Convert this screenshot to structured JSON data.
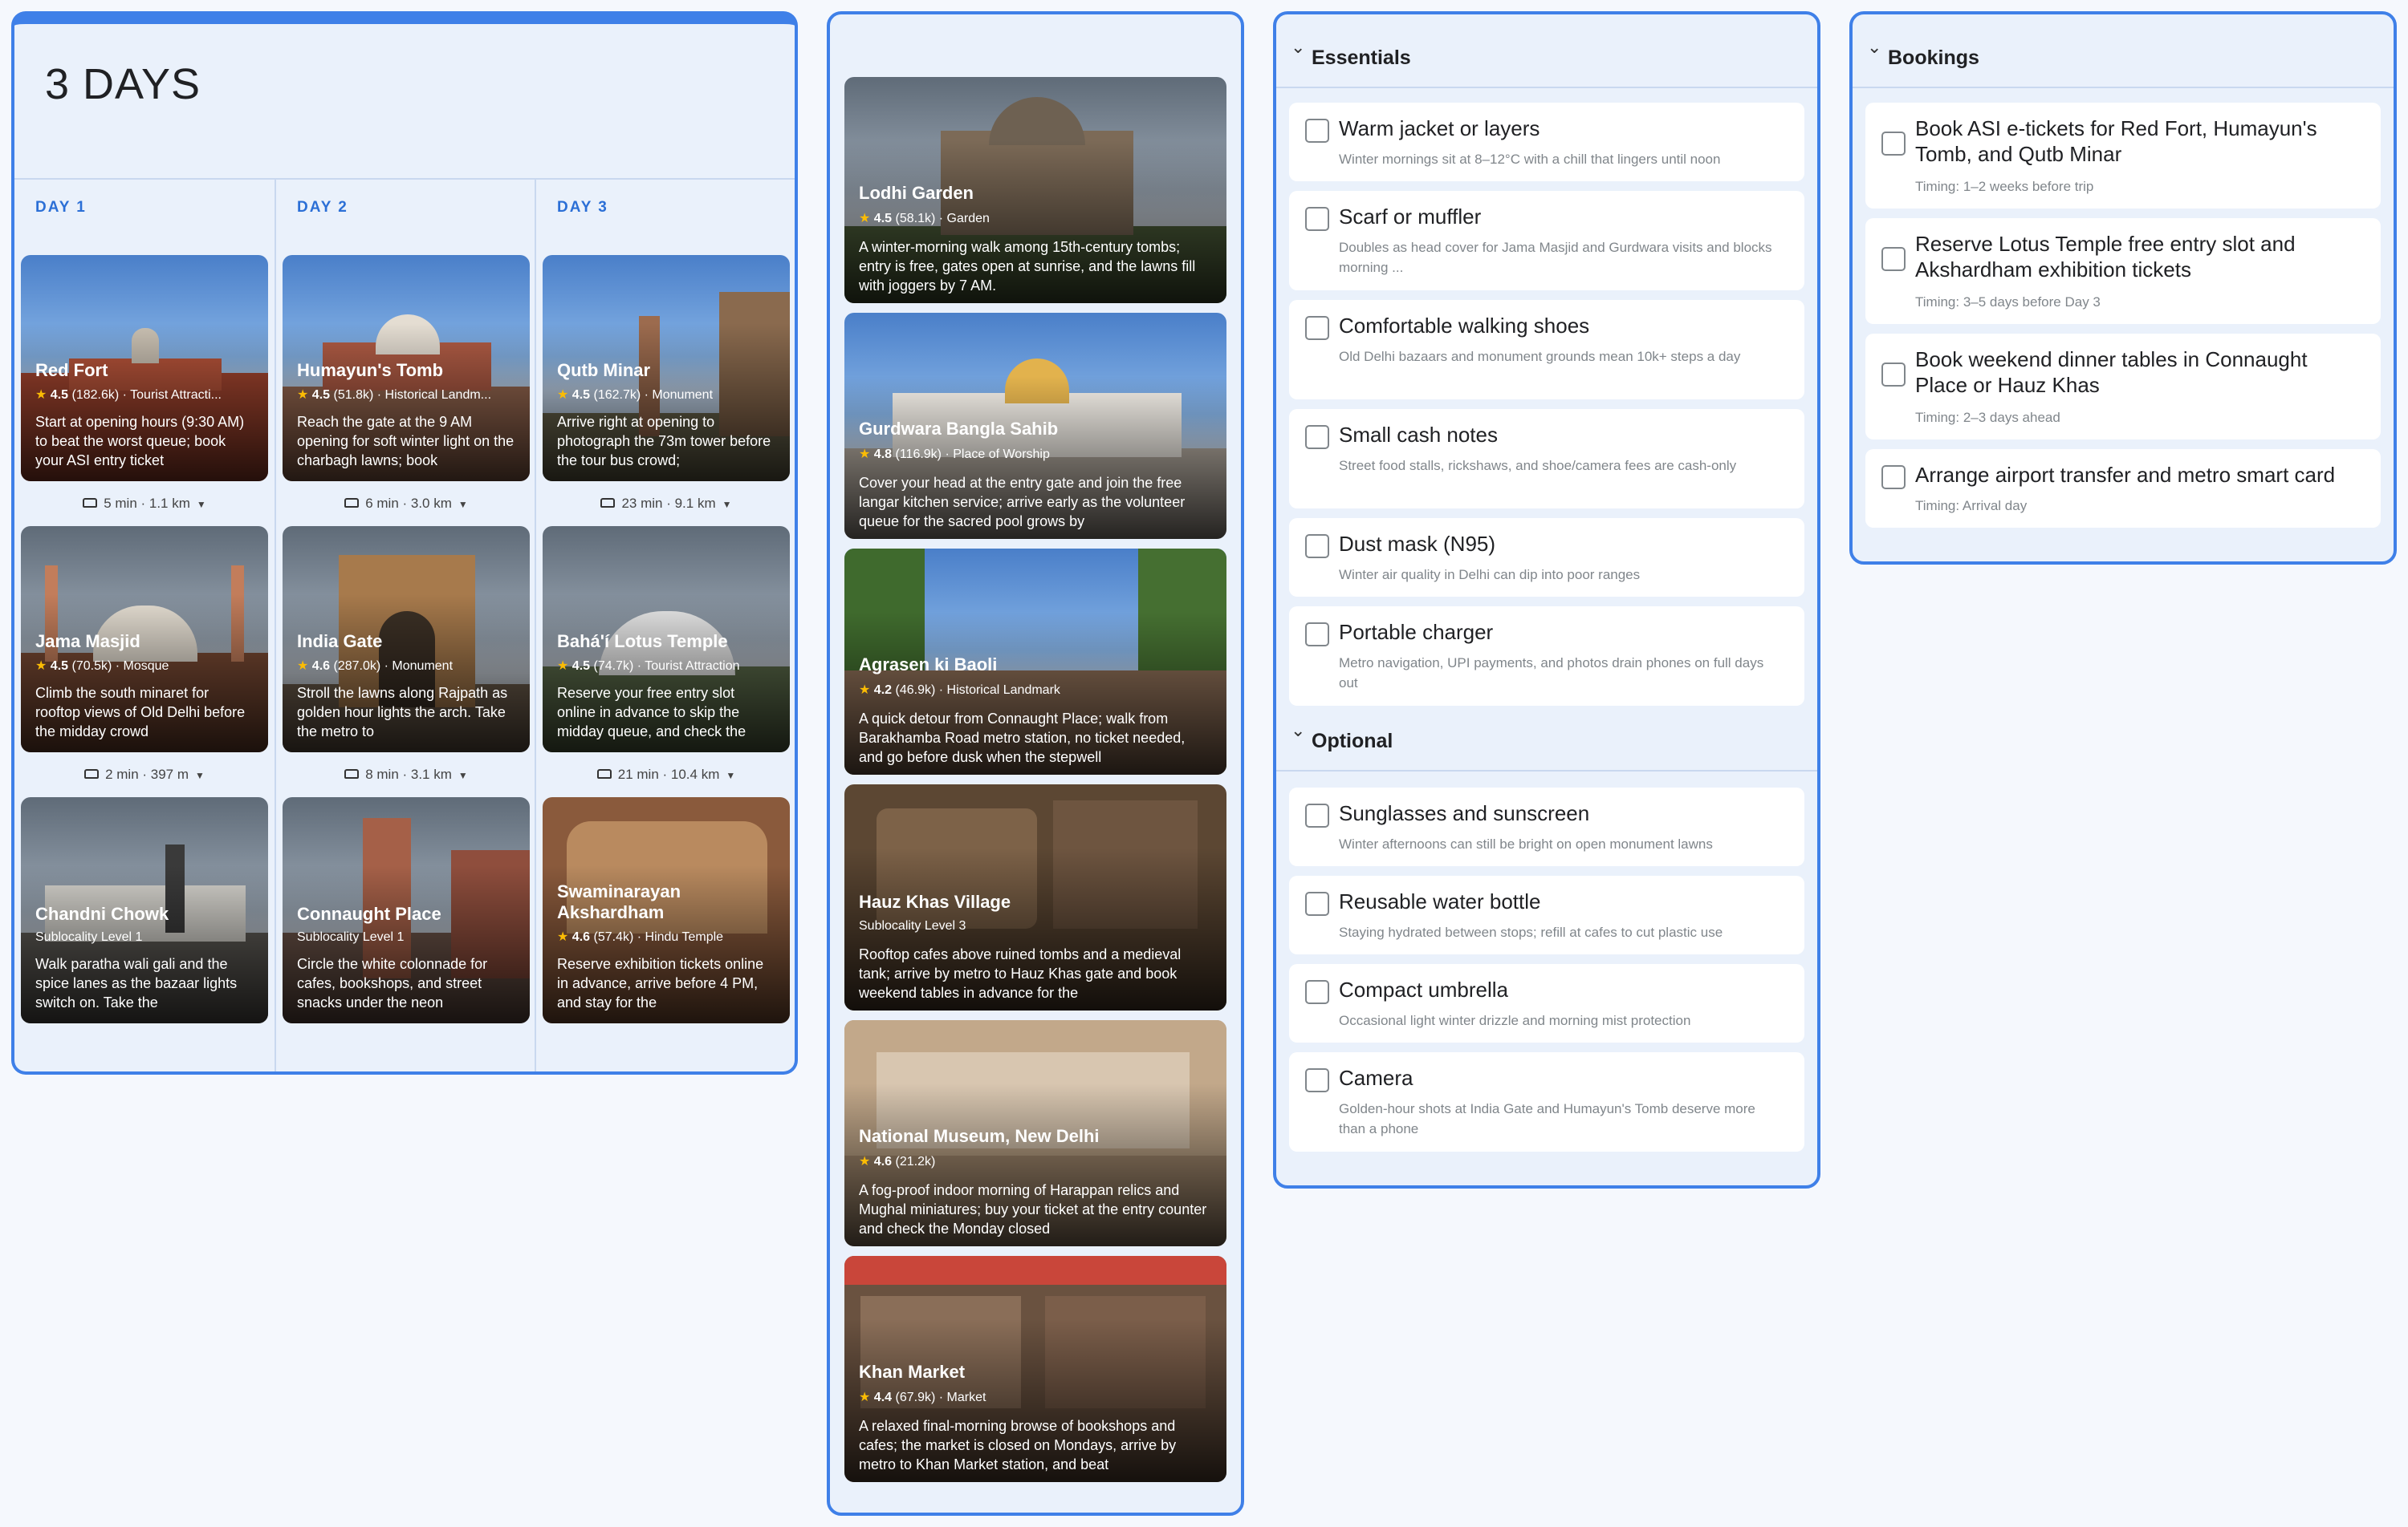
{
  "itinerary": {
    "title": "3 DAYS",
    "days": [
      {
        "label": "DAY 1",
        "places": [
          {
            "name": "Red Fort",
            "rating": "4.5",
            "reviews": "(182.6k)",
            "category": "Tourist Attracti...",
            "desc": "Start at opening hours (9:30 AM) to beat the worst queue; book your ASI entry ticket"
          },
          {
            "name": "Jama Masjid",
            "rating": "4.5",
            "reviews": "(70.5k)",
            "category": "Mosque",
            "desc": "Climb the south minaret for rooftop views of Old Delhi before the midday crowd"
          },
          {
            "name": "Chandni Chowk",
            "rating": "",
            "reviews": "",
            "category": "Sublocality Level 1",
            "desc": "Walk paratha wali gali and the spice lanes as the bazaar lights switch on. Take the"
          }
        ],
        "travel": [
          "5 min · 1.1 km",
          "2 min · 397 m"
        ]
      },
      {
        "label": "DAY 2",
        "places": [
          {
            "name": "Humayun's Tomb",
            "rating": "4.5",
            "reviews": "(51.8k)",
            "category": "Historical Landm...",
            "desc": "Reach the gate at the 9 AM opening for soft winter light on the charbagh lawns; book"
          },
          {
            "name": "India Gate",
            "rating": "4.6",
            "reviews": "(287.0k)",
            "category": "Monument",
            "desc": "Stroll the lawns along Rajpath as golden hour lights the arch. Take the metro to"
          },
          {
            "name": "Connaught Place",
            "rating": "",
            "reviews": "",
            "category": "Sublocality Level 1",
            "desc": "Circle the white colonnade for cafes, bookshops, and street snacks under the neon"
          }
        ],
        "travel": [
          "6 min · 3.0 km",
          "8 min · 3.1 km"
        ]
      },
      {
        "label": "DAY 3",
        "places": [
          {
            "name": "Qutb Minar",
            "rating": "4.5",
            "reviews": "(162.7k)",
            "category": "Monument",
            "desc": "Arrive right at opening to photograph the 73m tower before the tour bus crowd;"
          },
          {
            "name": "Bahá'í Lotus Temple",
            "rating": "4.5",
            "reviews": "(74.7k)",
            "category": "Tourist Attraction",
            "desc": "Reserve your free entry slot online in advance to skip the midday queue, and check the"
          },
          {
            "name": "Swaminarayan Akshardham",
            "rating": "4.6",
            "reviews": "(57.4k)",
            "category": "Hindu Temple",
            "desc": "Reserve exhibition tickets online in advance, arrive before 4 PM, and stay for the"
          }
        ],
        "travel": [
          "23 min · 9.1 km",
          "21 min · 10.4 km"
        ]
      }
    ]
  },
  "places_list": [
    {
      "name": "Lodhi Garden",
      "rating": "4.5",
      "reviews": "(58.1k)",
      "category": "Garden",
      "desc": "A winter-morning walk among 15th-century tombs; entry is free, gates open at sunrise, and the lawns fill with joggers by 7 AM."
    },
    {
      "name": "Gurdwara Bangla Sahib",
      "rating": "4.8",
      "reviews": "(116.9k)",
      "category": "Place of Worship",
      "desc": "Cover your head at the entry gate and join the free langar kitchen service; arrive early as the volunteer queue for the sacred pool grows by"
    },
    {
      "name": "Agrasen ki Baoli",
      "rating": "4.2",
      "reviews": "(46.9k)",
      "category": "Historical Landmark",
      "desc": "A quick detour from Connaught Place; walk from Barakhamba Road metro station, no ticket needed, and go before dusk when the stepwell"
    },
    {
      "name": "Hauz Khas Village",
      "rating": "",
      "reviews": "",
      "category": "Sublocality Level 3",
      "desc": "Rooftop cafes above ruined tombs and a medieval tank; arrive by metro to Hauz Khas gate and book weekend tables in advance for the"
    },
    {
      "name": "National Museum, New Delhi",
      "rating": "4.6",
      "reviews": "(21.2k)",
      "category": "",
      "desc": "A fog-proof indoor morning of Harappan relics and Mughal miniatures; buy your ticket at the entry counter and check the Monday closed"
    },
    {
      "name": "Khan Market",
      "rating": "4.4",
      "reviews": "(67.9k)",
      "category": "Market",
      "desc": "A relaxed final-morning browse of bookshops and cafes; the market is closed on Mondays, arrive by metro to Khan Market station, and beat"
    }
  ],
  "packing": {
    "essentials_label": "Essentials",
    "essentials": [
      {
        "title": "Warm jacket or layers",
        "sub": "Winter mornings sit at 8–12°C with a chill that lingers until noon"
      },
      {
        "title": "Scarf or muffler",
        "sub": "Doubles as head cover for Jama Masjid and Gurdwara visits and blocks morning ..."
      },
      {
        "title": "Comfortable walking shoes",
        "sub": "Old Delhi bazaars and monument grounds mean 10k+ steps a day"
      },
      {
        "title": "Small cash notes",
        "sub": "Street food stalls, rickshaws, and shoe/camera fees are cash-only"
      },
      {
        "title": "Dust mask (N95)",
        "sub": "Winter air quality in Delhi can dip into poor ranges"
      },
      {
        "title": "Portable charger",
        "sub": "Metro navigation, UPI payments, and photos drain phones on full days out"
      }
    ],
    "optional_label": "Optional",
    "optional": [
      {
        "title": "Sunglasses and sunscreen",
        "sub": "Winter afternoons can still be bright on open monument lawns"
      },
      {
        "title": "Reusable water bottle",
        "sub": "Staying hydrated between stops; refill at cafes to cut plastic use"
      },
      {
        "title": "Compact umbrella",
        "sub": "Occasional light winter drizzle and morning mist protection"
      },
      {
        "title": "Camera",
        "sub": "Golden-hour shots at India Gate and Humayun's Tomb deserve more than a phone"
      }
    ]
  },
  "bookings": {
    "label": "Bookings",
    "items": [
      {
        "title": "Book ASI e-tickets for Red Fort, Humayun's Tomb, and Qutb Minar",
        "sub": "Timing: 1–2 weeks before trip"
      },
      {
        "title": "Reserve Lotus Temple free entry slot and Akshardham exhibition tickets",
        "sub": "Timing: 3–5 days before Day 3"
      },
      {
        "title": "Book weekend dinner tables in Connaught Place or Hauz Khas",
        "sub": "Timing: 2–3 days ahead"
      },
      {
        "title": "Arrange airport transfer and metro smart card",
        "sub": "Timing: Arrival day"
      }
    ]
  },
  "colors": {
    "accent": "#3f80e8",
    "panel": "#eaf1fb",
    "star": "#fbbc04"
  },
  "icons": [
    "car-icon",
    "chevron-down-icon",
    "star-icon",
    "checkbox-icon"
  ]
}
